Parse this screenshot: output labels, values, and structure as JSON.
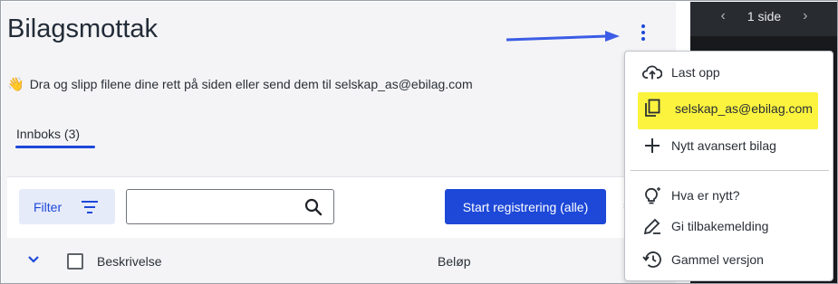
{
  "header": {
    "title": "Bilagsmottak"
  },
  "hint": {
    "text": "Dra og slipp filene dine rett på siden eller send dem til  selskap_as@ebilag.com"
  },
  "tabs": [
    {
      "label": "Innboks  (3)"
    }
  ],
  "toolbar": {
    "filter_label": "Filter",
    "search_placeholder": "",
    "start_label": "Start registrering (alle)"
  },
  "table": {
    "columns": [
      "Beskrivelse",
      "Beløp"
    ]
  },
  "viewer": {
    "pager_label": "1 side"
  },
  "menu": {
    "items": [
      {
        "label": "Last opp",
        "icon": "cloud-upload-icon"
      },
      {
        "label": "selskap_as@ebilag.com",
        "icon": "copy-icon"
      },
      {
        "label": "Nytt avansert bilag",
        "icon": "plus-icon"
      },
      {
        "label": "Hva er nytt?",
        "icon": "lightbulb-icon"
      },
      {
        "label": "Gi tilbakemelding",
        "icon": "feedback-icon"
      },
      {
        "label": "Gammel versjon",
        "icon": "history-icon"
      }
    ]
  },
  "colors": {
    "accent": "#1d48d8",
    "highlight": "#fbf33e",
    "arrow": "#3b5ce6"
  }
}
